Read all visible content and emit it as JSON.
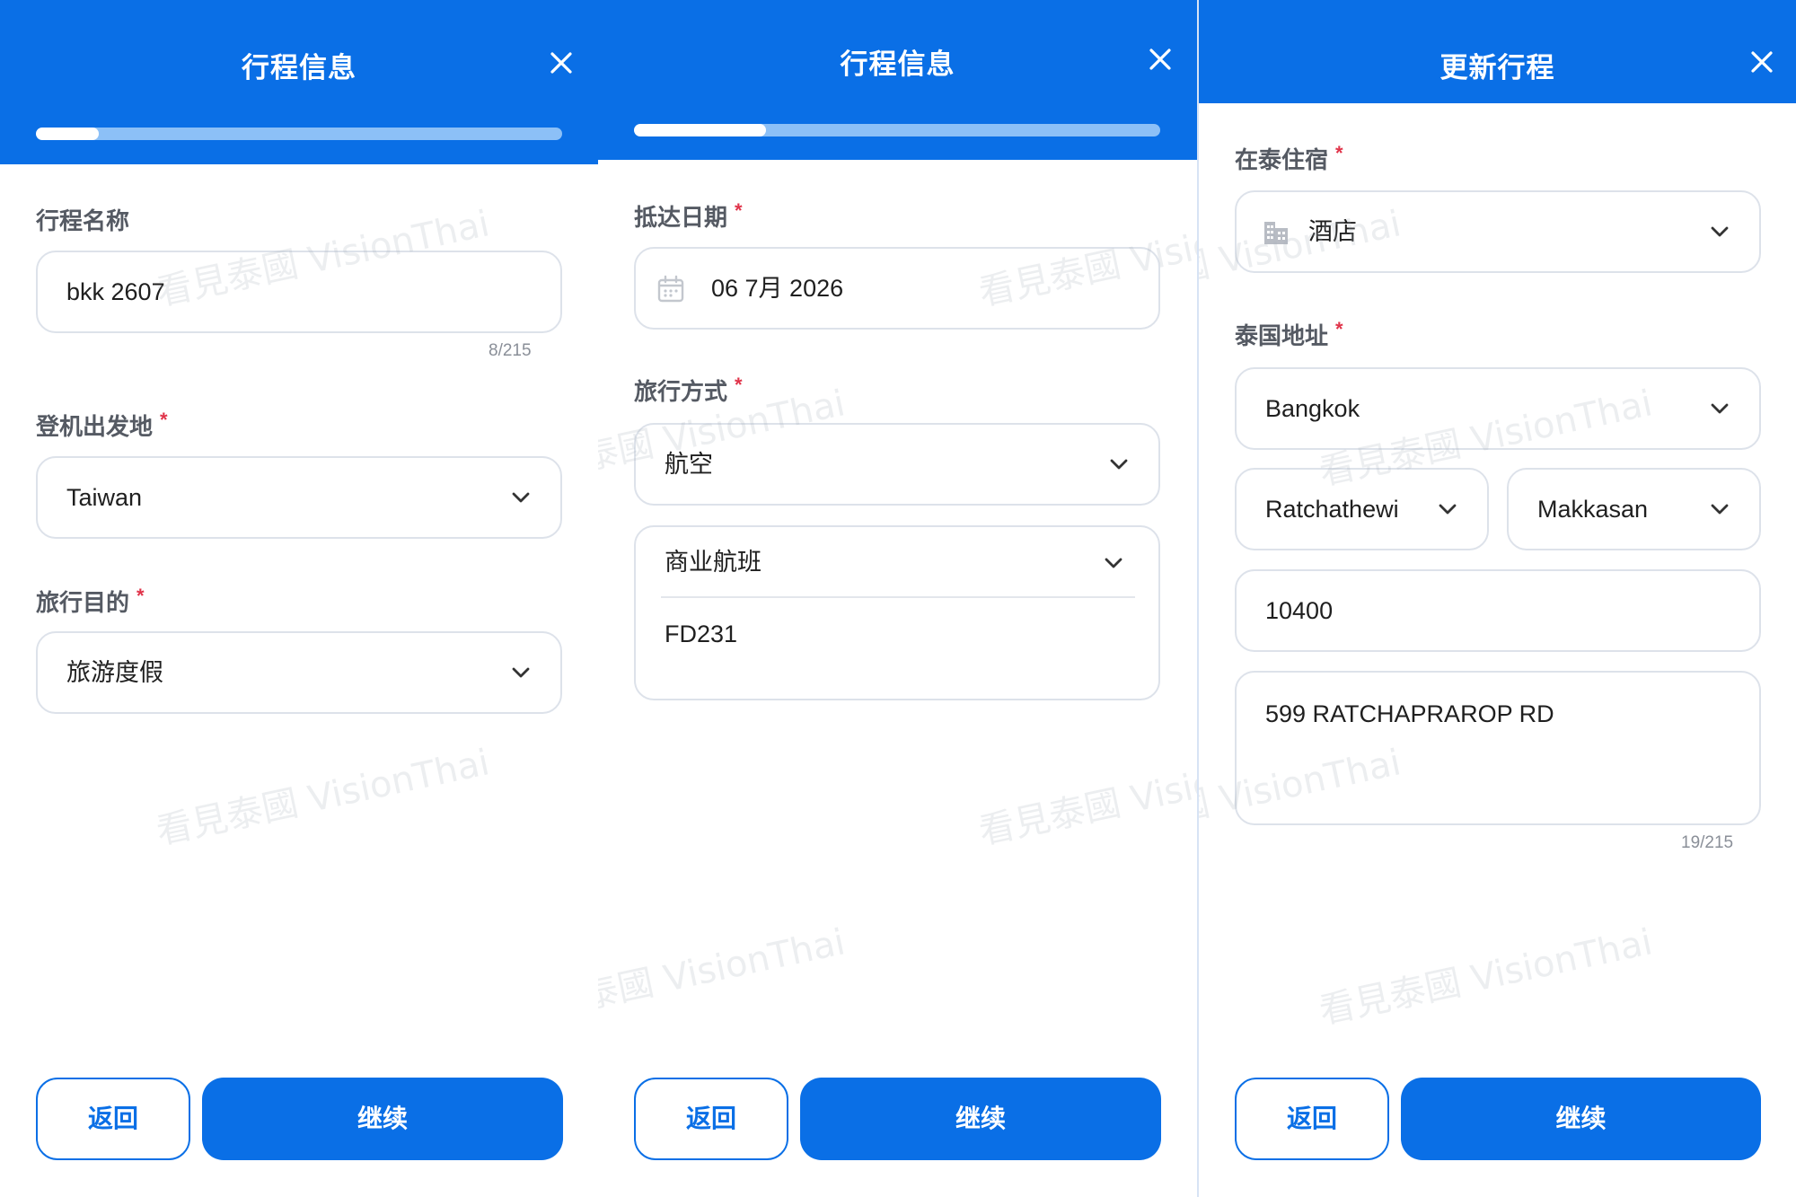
{
  "colors": {
    "accent": "#0a6fe6",
    "required": "#e0344a",
    "progress_track": "#8cc0f7"
  },
  "icons": {
    "close": "close-icon",
    "chevron": "chevron-down-icon",
    "calendar": "calendar-icon",
    "building": "building-icon"
  },
  "watermark": "看見泰國 VisionThai",
  "panels": [
    {
      "title": "行程信息",
      "progress": 0.12,
      "fields": {
        "trip_name_label": "行程名称",
        "trip_name_value": "bkk 2607",
        "trip_name_counter": "8/215",
        "departure_label": "登机出发地",
        "departure_value": "Taiwan",
        "purpose_label": "旅行目的",
        "purpose_value": "旅游度假"
      },
      "back_label": "返回",
      "continue_label": "继续"
    },
    {
      "title": "行程信息",
      "progress": 0.25,
      "fields": {
        "arrival_date_label": "抵达日期",
        "arrival_date_value": "06 7月 2026",
        "travel_mode_label": "旅行方式",
        "travel_mode_value": "航空",
        "flight_type_value": "商业航班",
        "flight_number_value": "FD231"
      },
      "back_label": "返回",
      "continue_label": "继续"
    },
    {
      "title": "更新行程",
      "fields": {
        "accommodation_label": "在泰住宿",
        "accommodation_value": "酒店",
        "address_label": "泰国地址",
        "province_value": "Bangkok",
        "district_value": "Ratchathewi",
        "subdistrict_value": "Makkasan",
        "postcode_value": "10400",
        "street_value": "599 RATCHAPRAROP RD",
        "street_counter": "19/215"
      },
      "back_label": "返回",
      "continue_label": "继续"
    }
  ],
  "required_mark": "*"
}
